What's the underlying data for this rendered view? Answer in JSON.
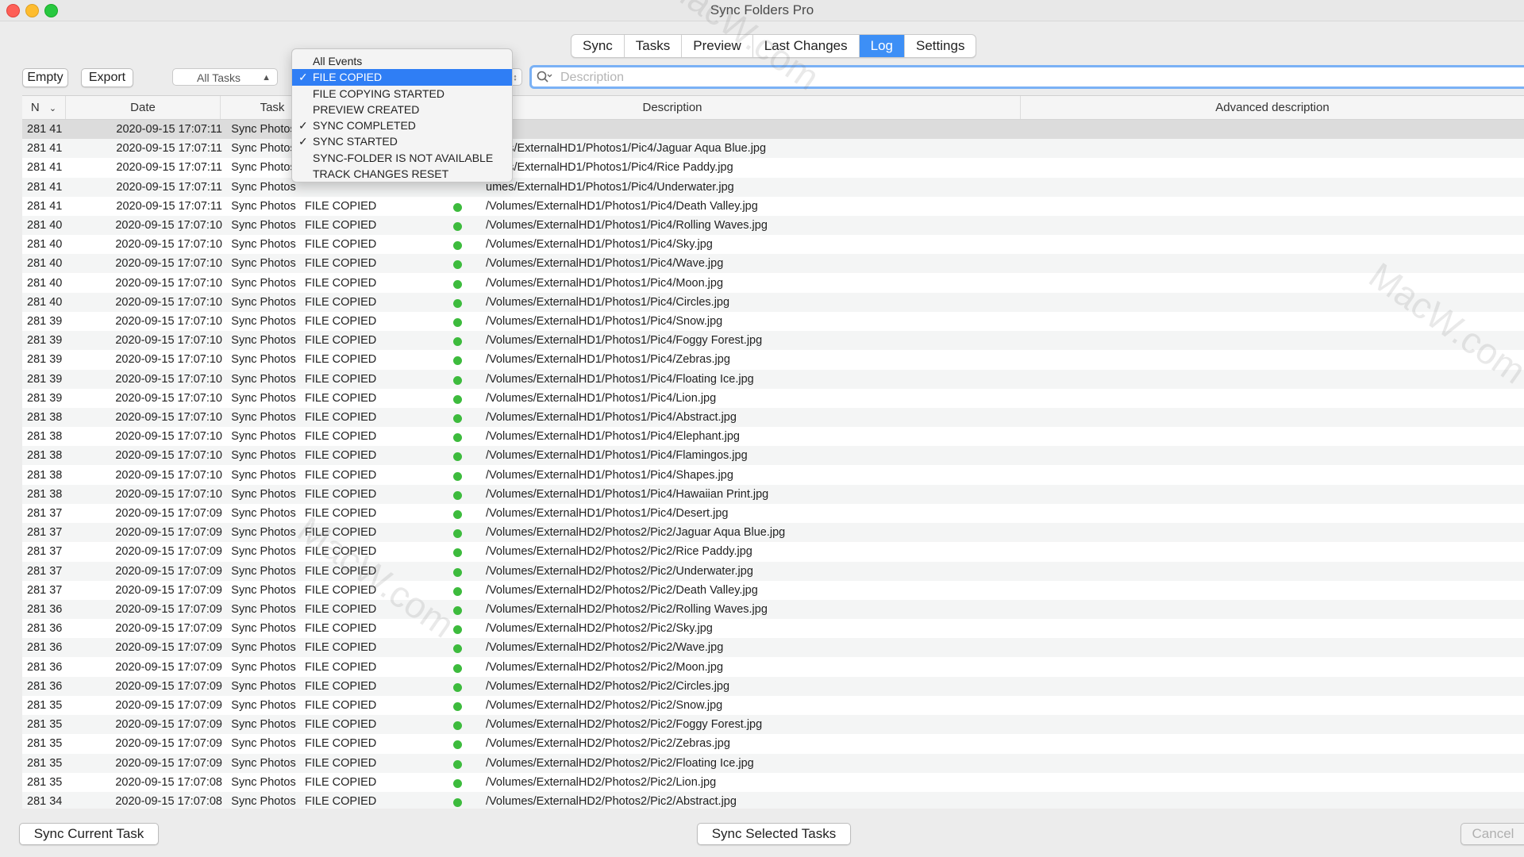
{
  "window": {
    "title": "Sync Folders Pro"
  },
  "tabs": [
    "Sync",
    "Tasks",
    "Preview",
    "Last Changes",
    "Log",
    "Settings"
  ],
  "active_tab": "Log",
  "toolbar": {
    "empty_label": "Empty",
    "export_label": "Export",
    "task_filter": "All Tasks",
    "search_placeholder": "Description"
  },
  "event_menu": {
    "items": [
      {
        "label": "All Events",
        "checked": false,
        "highlighted": false
      },
      {
        "label": "FILE COPIED",
        "checked": true,
        "highlighted": true
      },
      {
        "label": "FILE COPYING STARTED",
        "checked": false,
        "highlighted": false
      },
      {
        "label": "PREVIEW CREATED",
        "checked": false,
        "highlighted": false
      },
      {
        "label": "SYNC COMPLETED",
        "checked": true,
        "highlighted": false
      },
      {
        "label": "SYNC STARTED",
        "checked": true,
        "highlighted": false
      },
      {
        "label": "SYNC-FOLDER IS NOT AVAILABLE",
        "checked": false,
        "highlighted": false
      },
      {
        "label": "TRACK CHANGES RESET",
        "checked": false,
        "highlighted": false
      }
    ]
  },
  "table": {
    "columns": {
      "n": "N",
      "date": "Date",
      "task": "Task",
      "description": "Description",
      "advanced": "Advanced description"
    },
    "status_color": "#3dbb3d",
    "rows": [
      {
        "n": "281 41",
        "date": "2020-09-15 17:07:11",
        "task": "Sync Photos",
        "event": "",
        "desc": ""
      },
      {
        "n": "281 41",
        "date": "2020-09-15 17:07:11",
        "task": "Sync Photos",
        "event": "",
        "desc": "umes/ExternalHD1/Photos1/Pic4/Jaguar Aqua Blue.jpg"
      },
      {
        "n": "281 41",
        "date": "2020-09-15 17:07:11",
        "task": "Sync Photos",
        "event": "",
        "desc": "umes/ExternalHD1/Photos1/Pic4/Rice Paddy.jpg"
      },
      {
        "n": "281 41",
        "date": "2020-09-15 17:07:11",
        "task": "Sync Photos",
        "event": "",
        "desc": "umes/ExternalHD1/Photos1/Pic4/Underwater.jpg"
      },
      {
        "n": "281 41",
        "date": "2020-09-15 17:07:11",
        "task": "Sync Photos",
        "event": "FILE COPIED",
        "desc": "/Volumes/ExternalHD1/Photos1/Pic4/Death Valley.jpg"
      },
      {
        "n": "281 40",
        "date": "2020-09-15 17:07:10",
        "task": "Sync Photos",
        "event": "FILE COPIED",
        "desc": "/Volumes/ExternalHD1/Photos1/Pic4/Rolling Waves.jpg"
      },
      {
        "n": "281 40",
        "date": "2020-09-15 17:07:10",
        "task": "Sync Photos",
        "event": "FILE COPIED",
        "desc": "/Volumes/ExternalHD1/Photos1/Pic4/Sky.jpg"
      },
      {
        "n": "281 40",
        "date": "2020-09-15 17:07:10",
        "task": "Sync Photos",
        "event": "FILE COPIED",
        "desc": "/Volumes/ExternalHD1/Photos1/Pic4/Wave.jpg"
      },
      {
        "n": "281 40",
        "date": "2020-09-15 17:07:10",
        "task": "Sync Photos",
        "event": "FILE COPIED",
        "desc": "/Volumes/ExternalHD1/Photos1/Pic4/Moon.jpg"
      },
      {
        "n": "281 40",
        "date": "2020-09-15 17:07:10",
        "task": "Sync Photos",
        "event": "FILE COPIED",
        "desc": "/Volumes/ExternalHD1/Photos1/Pic4/Circles.jpg"
      },
      {
        "n": "281 39",
        "date": "2020-09-15 17:07:10",
        "task": "Sync Photos",
        "event": "FILE COPIED",
        "desc": "/Volumes/ExternalHD1/Photos1/Pic4/Snow.jpg"
      },
      {
        "n": "281 39",
        "date": "2020-09-15 17:07:10",
        "task": "Sync Photos",
        "event": "FILE COPIED",
        "desc": "/Volumes/ExternalHD1/Photos1/Pic4/Foggy Forest.jpg"
      },
      {
        "n": "281 39",
        "date": "2020-09-15 17:07:10",
        "task": "Sync Photos",
        "event": "FILE COPIED",
        "desc": "/Volumes/ExternalHD1/Photos1/Pic4/Zebras.jpg"
      },
      {
        "n": "281 39",
        "date": "2020-09-15 17:07:10",
        "task": "Sync Photos",
        "event": "FILE COPIED",
        "desc": "/Volumes/ExternalHD1/Photos1/Pic4/Floating Ice.jpg"
      },
      {
        "n": "281 39",
        "date": "2020-09-15 17:07:10",
        "task": "Sync Photos",
        "event": "FILE COPIED",
        "desc": "/Volumes/ExternalHD1/Photos1/Pic4/Lion.jpg"
      },
      {
        "n": "281 38",
        "date": "2020-09-15 17:07:10",
        "task": "Sync Photos",
        "event": "FILE COPIED",
        "desc": "/Volumes/ExternalHD1/Photos1/Pic4/Abstract.jpg"
      },
      {
        "n": "281 38",
        "date": "2020-09-15 17:07:10",
        "task": "Sync Photos",
        "event": "FILE COPIED",
        "desc": "/Volumes/ExternalHD1/Photos1/Pic4/Elephant.jpg"
      },
      {
        "n": "281 38",
        "date": "2020-09-15 17:07:10",
        "task": "Sync Photos",
        "event": "FILE COPIED",
        "desc": "/Volumes/ExternalHD1/Photos1/Pic4/Flamingos.jpg"
      },
      {
        "n": "281 38",
        "date": "2020-09-15 17:07:10",
        "task": "Sync Photos",
        "event": "FILE COPIED",
        "desc": "/Volumes/ExternalHD1/Photos1/Pic4/Shapes.jpg"
      },
      {
        "n": "281 38",
        "date": "2020-09-15 17:07:10",
        "task": "Sync Photos",
        "event": "FILE COPIED",
        "desc": "/Volumes/ExternalHD1/Photos1/Pic4/Hawaiian Print.jpg"
      },
      {
        "n": "281 37",
        "date": "2020-09-15 17:07:09",
        "task": "Sync Photos",
        "event": "FILE COPIED",
        "desc": "/Volumes/ExternalHD1/Photos1/Pic4/Desert.jpg"
      },
      {
        "n": "281 37",
        "date": "2020-09-15 17:07:09",
        "task": "Sync Photos",
        "event": "FILE COPIED",
        "desc": "/Volumes/ExternalHD2/Photos2/Pic2/Jaguar Aqua Blue.jpg"
      },
      {
        "n": "281 37",
        "date": "2020-09-15 17:07:09",
        "task": "Sync Photos",
        "event": "FILE COPIED",
        "desc": "/Volumes/ExternalHD2/Photos2/Pic2/Rice Paddy.jpg"
      },
      {
        "n": "281 37",
        "date": "2020-09-15 17:07:09",
        "task": "Sync Photos",
        "event": "FILE COPIED",
        "desc": "/Volumes/ExternalHD2/Photos2/Pic2/Underwater.jpg"
      },
      {
        "n": "281 37",
        "date": "2020-09-15 17:07:09",
        "task": "Sync Photos",
        "event": "FILE COPIED",
        "desc": "/Volumes/ExternalHD2/Photos2/Pic2/Death Valley.jpg"
      },
      {
        "n": "281 36",
        "date": "2020-09-15 17:07:09",
        "task": "Sync Photos",
        "event": "FILE COPIED",
        "desc": "/Volumes/ExternalHD2/Photos2/Pic2/Rolling Waves.jpg"
      },
      {
        "n": "281 36",
        "date": "2020-09-15 17:07:09",
        "task": "Sync Photos",
        "event": "FILE COPIED",
        "desc": "/Volumes/ExternalHD2/Photos2/Pic2/Sky.jpg"
      },
      {
        "n": "281 36",
        "date": "2020-09-15 17:07:09",
        "task": "Sync Photos",
        "event": "FILE COPIED",
        "desc": "/Volumes/ExternalHD2/Photos2/Pic2/Wave.jpg"
      },
      {
        "n": "281 36",
        "date": "2020-09-15 17:07:09",
        "task": "Sync Photos",
        "event": "FILE COPIED",
        "desc": "/Volumes/ExternalHD2/Photos2/Pic2/Moon.jpg"
      },
      {
        "n": "281 36",
        "date": "2020-09-15 17:07:09",
        "task": "Sync Photos",
        "event": "FILE COPIED",
        "desc": "/Volumes/ExternalHD2/Photos2/Pic2/Circles.jpg"
      },
      {
        "n": "281 35",
        "date": "2020-09-15 17:07:09",
        "task": "Sync Photos",
        "event": "FILE COPIED",
        "desc": "/Volumes/ExternalHD2/Photos2/Pic2/Snow.jpg"
      },
      {
        "n": "281 35",
        "date": "2020-09-15 17:07:09",
        "task": "Sync Photos",
        "event": "FILE COPIED",
        "desc": "/Volumes/ExternalHD2/Photos2/Pic2/Foggy Forest.jpg"
      },
      {
        "n": "281 35",
        "date": "2020-09-15 17:07:09",
        "task": "Sync Photos",
        "event": "FILE COPIED",
        "desc": "/Volumes/ExternalHD2/Photos2/Pic2/Zebras.jpg"
      },
      {
        "n": "281 35",
        "date": "2020-09-15 17:07:09",
        "task": "Sync Photos",
        "event": "FILE COPIED",
        "desc": "/Volumes/ExternalHD2/Photos2/Pic2/Floating Ice.jpg"
      },
      {
        "n": "281 35",
        "date": "2020-09-15 17:07:08",
        "task": "Sync Photos",
        "event": "FILE COPIED",
        "desc": "/Volumes/ExternalHD2/Photos2/Pic2/Lion.jpg"
      },
      {
        "n": "281 34",
        "date": "2020-09-15 17:07:08",
        "task": "Sync Photos",
        "event": "FILE COPIED",
        "desc": "/Volumes/ExternalHD2/Photos2/Pic2/Abstract.jpg"
      }
    ]
  },
  "footer": {
    "sync_current_label": "Sync Current Task",
    "sync_selected_label": "Sync Selected Tasks",
    "cancel_label": "Cancel"
  },
  "watermark_text": "MacW.com"
}
